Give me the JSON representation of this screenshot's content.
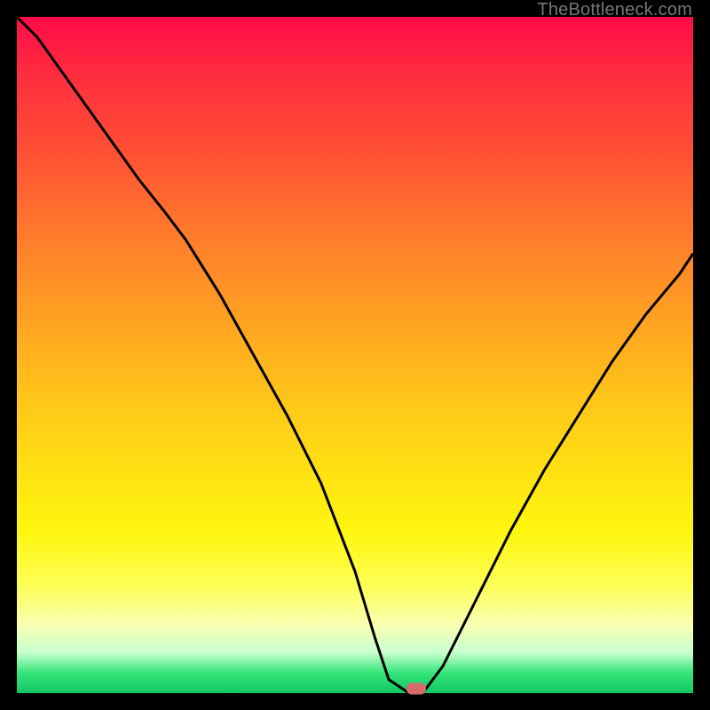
{
  "watermark": {
    "text": "TheBottleneck.com"
  },
  "colors": {
    "curve_stroke": "#000000",
    "marker_fill": "#d86a6a",
    "frame_bg": "#000000"
  },
  "chart_data": {
    "type": "line",
    "title": "",
    "xlabel": "",
    "ylabel": "",
    "xlim": [
      0,
      100
    ],
    "ylim": [
      0,
      100
    ],
    "grid": false,
    "x": [
      0,
      3,
      8,
      13,
      18,
      22,
      25,
      30,
      35,
      40,
      45,
      50,
      53,
      55,
      58,
      60,
      63,
      68,
      73,
      78,
      83,
      88,
      93,
      98,
      100
    ],
    "series": [
      {
        "name": "bottleneck-curve",
        "values": [
          100,
          97,
          90,
          83,
          76,
          71,
          67,
          59,
          50,
          41,
          31,
          18,
          8,
          2,
          0,
          0,
          4,
          14,
          24,
          33,
          41,
          49,
          56,
          62,
          65
        ]
      }
    ],
    "marker": {
      "x": 59,
      "y": 0.7
    }
  }
}
